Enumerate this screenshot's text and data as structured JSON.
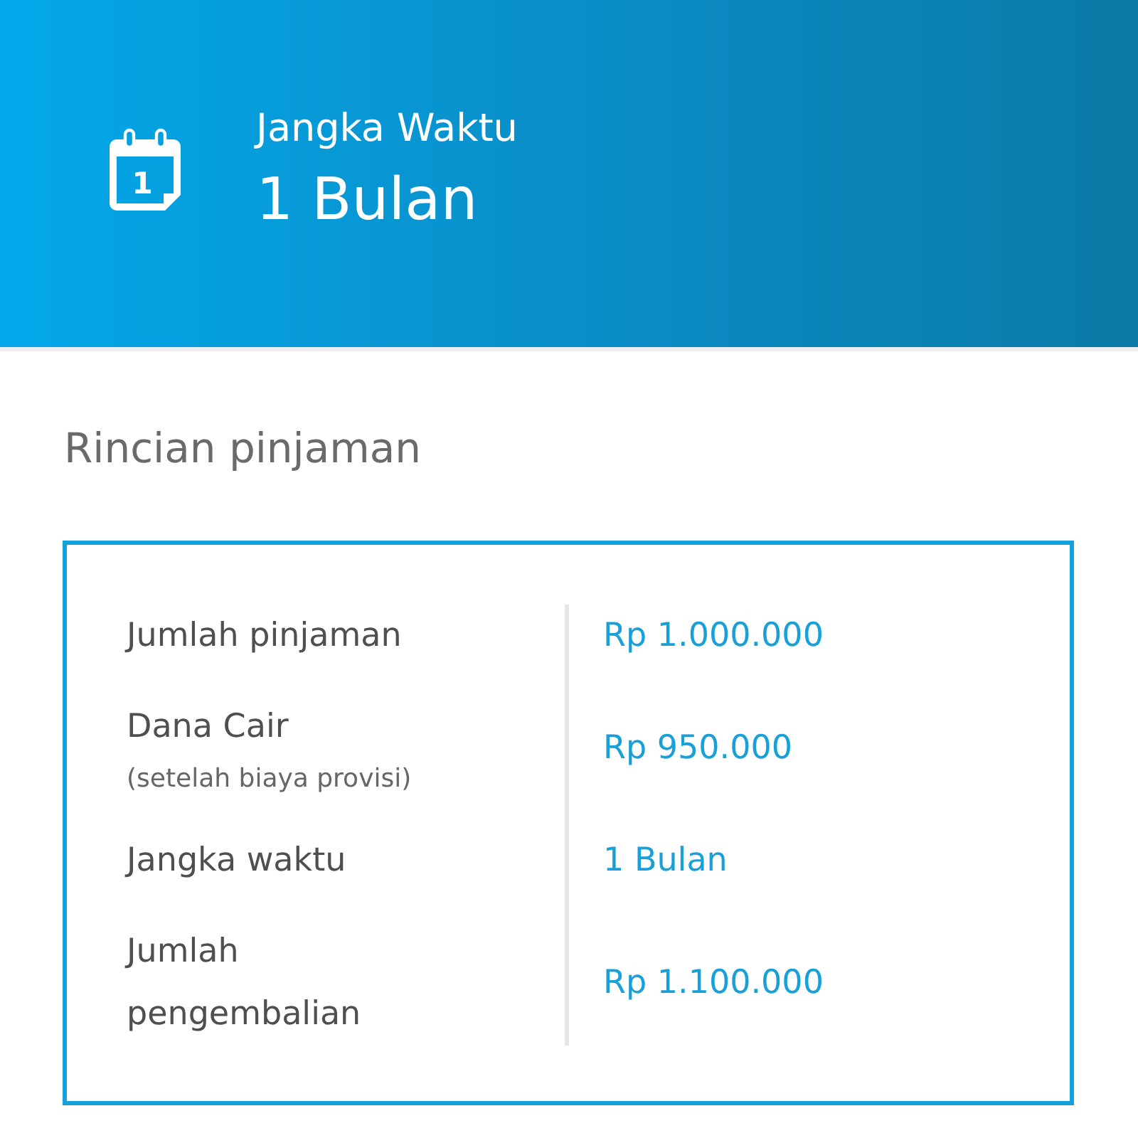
{
  "header": {
    "icon_day": "1",
    "label": "Jangka Waktu",
    "value": "1 Bulan"
  },
  "details": {
    "title": "Rincian pinjaman",
    "rows": [
      {
        "label": "Jumlah pinjaman",
        "value": "Rp 1.000.000"
      },
      {
        "label": "Dana Cair",
        "note": "(setelah biaya provisi)",
        "value": "Rp 950.000"
      },
      {
        "label": "Jangka waktu",
        "value": "1 Bulan"
      },
      {
        "label": "Jumlah pengembalian",
        "value": "Rp 1.100.000"
      }
    ]
  }
}
